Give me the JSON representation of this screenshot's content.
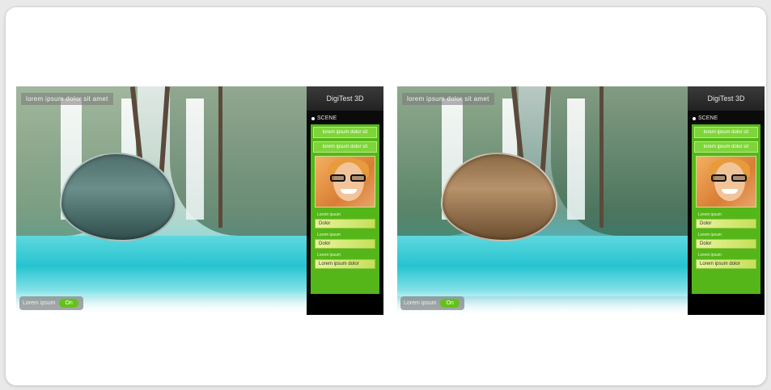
{
  "panels": [
    {
      "scene_label": "lorem ipsum dolor sit amet",
      "lens_tint": "#5f817c",
      "compare_label": "Lorem ipsum",
      "compare_button": "On",
      "sidebar": {
        "brand": "DigiTest 3D",
        "section": "SCENE",
        "buttons": [
          "lorem ipsum dolor sit",
          "lorem ipsum dolor sit"
        ],
        "fields": [
          {
            "label": "Lorem ipsum",
            "value": "Dolor"
          },
          {
            "label": "Lorem ipsum",
            "value": "Dolor"
          },
          {
            "label": "Lorem ipsum",
            "value": "Lorem ipsum dolor"
          }
        ]
      }
    },
    {
      "scene_label": "lorem ipsum dolor sit amet",
      "lens_tint": "#9a7850",
      "compare_label": "Lorem ipsum",
      "compare_button": "On",
      "sidebar": {
        "brand": "DigiTest 3D",
        "section": "SCENE",
        "buttons": [
          "lorem ipsum dolor sit",
          "lorem ipsum dolor sit"
        ],
        "fields": [
          {
            "label": "Lorem ipsum",
            "value": "Dolor"
          },
          {
            "label": "Lorem ipsum",
            "value": "Dolor"
          },
          {
            "label": "Lorem ipsum",
            "value": "Lorem ipsum dolor"
          }
        ]
      }
    }
  ],
  "colors": {
    "accent_green": "#55b61a",
    "button_green": "#63c21a",
    "sidebar_bg": "#0b0b0b"
  }
}
